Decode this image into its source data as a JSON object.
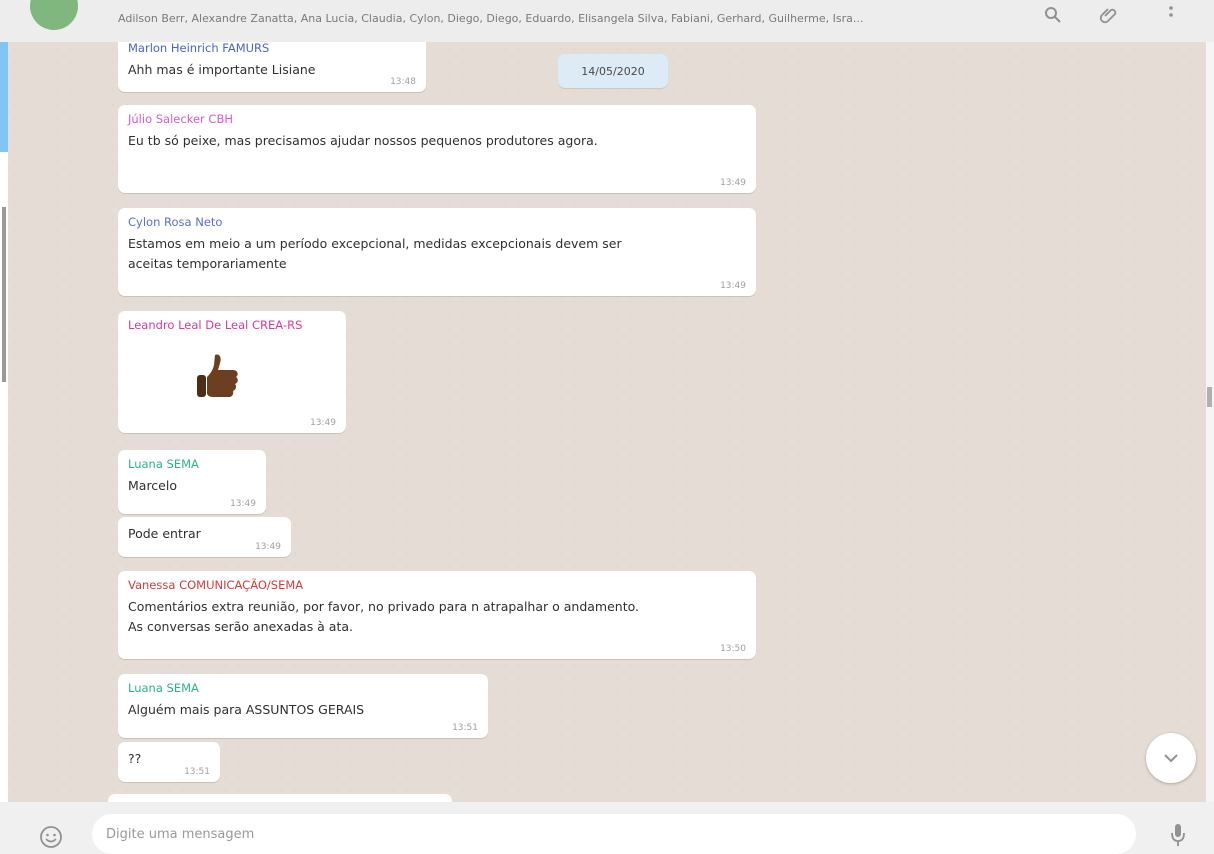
{
  "header": {
    "members": "Adilson Berr, Alexandre Zanatta, Ana Lucia, Claudia, Cylon, Diego, Diego, Eduardo, Elisangela Silva, Fabiani, Gerhard, Guilherme, Isra..."
  },
  "date_pill": "14/05/2020",
  "messages": [
    {
      "sender": "Marlon Heinrich FAMURS",
      "text": "Ahh mas é importante Lisiane",
      "time": "13:48",
      "sender_color": "#4a62c9"
    },
    {
      "sender": "Júlio Salecker CBH",
      "text": "Eu tb só peixe, mas precisamos ajudar nossos pequenos produtores agora.",
      "time": "13:49",
      "sender_color": "#d45bd8"
    },
    {
      "sender": "Cylon Rosa Neto",
      "text_line1": "Estamos em meio a um período excepcional, medidas excepcionais devem ser",
      "text_line2": "aceitas temporariamente",
      "time": "13:49",
      "sender_color": "#5a6fd1"
    },
    {
      "sender": "Leandro Leal De Leal CREA-RS",
      "time": "13:49",
      "sender_color": "#d83a9a"
    },
    {
      "sender": "Luana SEMA",
      "text": "Marcelo",
      "time": "13:49",
      "sender_color": "#2bb28a"
    },
    {
      "text": "Pode entrar",
      "time": "13:49"
    },
    {
      "sender": "Vanessa COMUNICAÇÃO/SEMA",
      "text_line1": "Comentários extra reunião, por favor, no privado para n atrapalhar o andamento.",
      "text_line2": "As conversas serão anexadas à ata.",
      "time": "13:50",
      "sender_color": "#d33b3b"
    },
    {
      "sender": "Luana SEMA",
      "text": "Alguém mais para ASSUNTOS GERAIS",
      "time": "13:51",
      "sender_color": "#2bb28a"
    },
    {
      "text": "??",
      "time": "13:51"
    }
  ],
  "composer": {
    "placeholder": "Digite uma mensagem"
  },
  "icons": {
    "search": "search-icon",
    "attach": "paperclip-icon",
    "menu": "more-vertical-icon",
    "emoji": "emoji-icon",
    "mic": "microphone-icon",
    "scroll": "chevron-down-icon",
    "sticker": "thumbs-up-sticker"
  }
}
